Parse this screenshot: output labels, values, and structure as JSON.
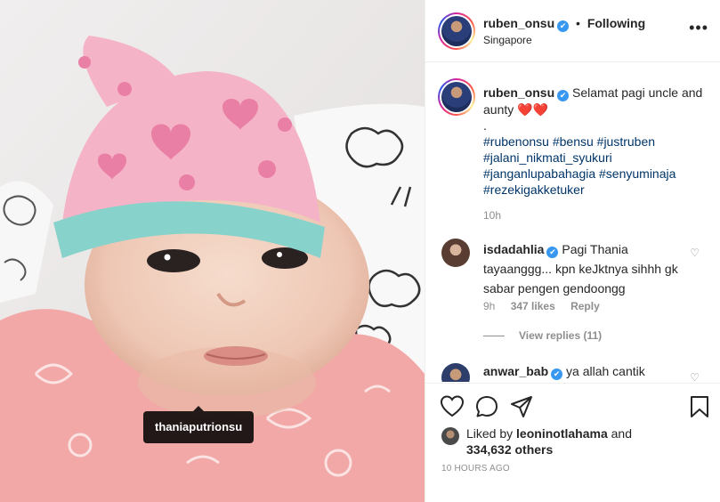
{
  "photo": {
    "tag_label": "thaniaputrionsu"
  },
  "header": {
    "username": "ruben_onsu",
    "verified_mark": "✔",
    "separator": "•",
    "follow_status": "Following",
    "location": "Singapore",
    "more_icon": "•••"
  },
  "caption": {
    "username": "ruben_onsu",
    "text": "Selamat pagi uncle and aunty",
    "hearts": "❤️❤️",
    "dot": ".",
    "hashtags_line1": "#rubenonsu #bensu #justruben",
    "hashtags_line2": "#jalani_nikmati_syukuri",
    "hashtags_line3": "#janganlupabahagia #senyuminaja",
    "hashtags_line4": "#rezekigakketuker",
    "time": "10h"
  },
  "comments": [
    {
      "username": "isdadahlia",
      "text": "Pagi Thania tayaanggg... kpn keJktnya sihhh gk sabar pengen gendoongg",
      "time": "9h",
      "likes": "347 likes",
      "reply": "Reply",
      "view_replies": "View replies (11)"
    },
    {
      "username": "anwar_bab",
      "text": "ya allah cantik"
    }
  ],
  "actions": {
    "liked_by_prefix": "Liked by",
    "liked_by_user": "leoninotlahama",
    "liked_by_joiner": "and",
    "others": "334,632 others",
    "timestamp": "10 HOURS AGO"
  },
  "colors": {
    "link": "#003569",
    "verified": "#3897f0",
    "muted": "#8e8e8e",
    "text": "#262626",
    "heart_red": "#ed4956"
  }
}
